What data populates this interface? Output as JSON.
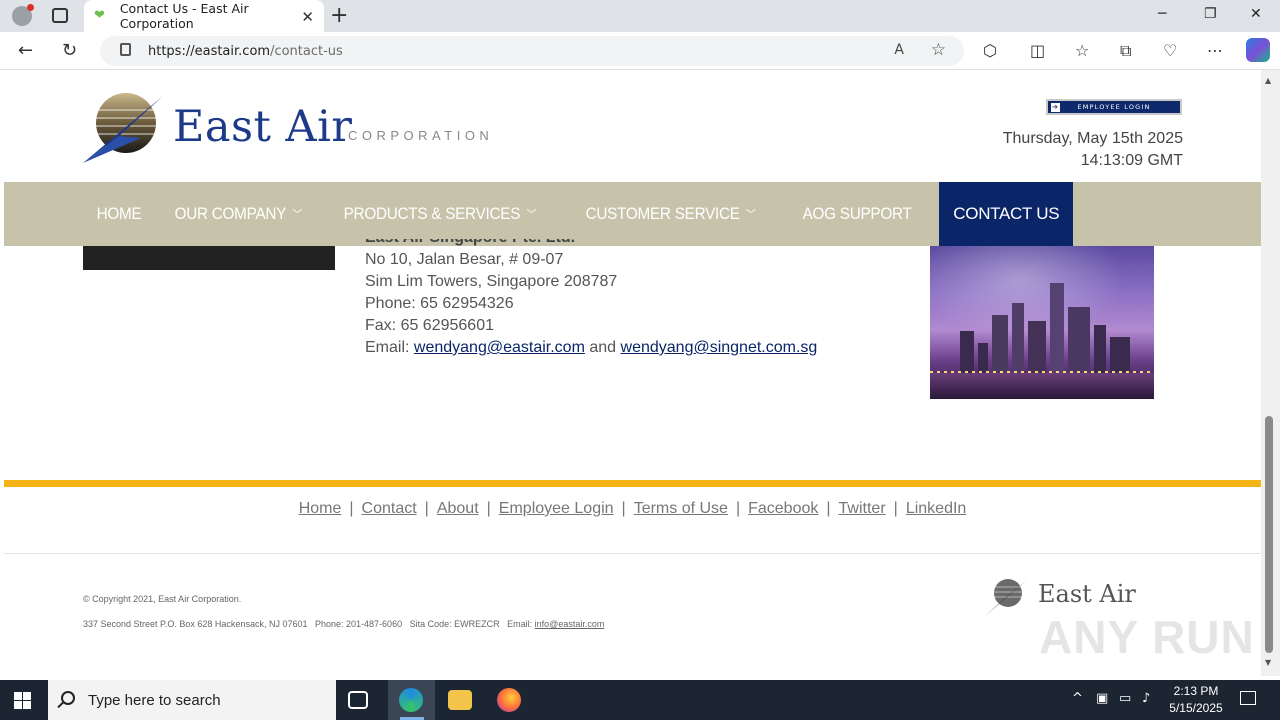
{
  "browser": {
    "tab_title": "Contact Us - East Air Corporation",
    "url_host": "https://eastair.com",
    "url_path": "/contact-us"
  },
  "header": {
    "logo_text": "East Air",
    "logo_sub": "CORPORATION",
    "employee_login": "EMPLOYEE LOGIN",
    "date": "Thursday, May 15th 2025",
    "time": "14:13:09 GMT"
  },
  "nav": {
    "items": [
      {
        "label": "HOME"
      },
      {
        "label": "OUR COMPANY"
      },
      {
        "label": "PRODUCTS & SERVICES"
      },
      {
        "label": "CUSTOMER SERVICE"
      },
      {
        "label": "AOG SUPPORT"
      },
      {
        "label": "CONTACT US"
      }
    ],
    "active_color": "#0a2668",
    "bar_color": "#c6c3aa"
  },
  "office": {
    "name": "East Air Singapore Pte. Ltd.",
    "line1": "No 10, Jalan Besar, # 09-07",
    "line2": "Sim Lim Towers, Singapore 208787",
    "phone": "Phone: 65 62954326",
    "fax": "Fax: 65 62956601",
    "email_label": "Email:",
    "email1": "wendyang@eastair.com",
    "and": "and",
    "email2": "wendyang@singnet.com.sg"
  },
  "footer": {
    "links": [
      "Home",
      "Contact",
      "About",
      "Employee Login",
      "Terms of Use",
      "Facebook",
      "Twitter",
      "LinkedIn"
    ],
    "copyright": "© Copyright 2021, East Air Corporation.",
    "address": "337 Second Street P.O. Box 628 Hackensack, NJ 07601",
    "phone": "Phone: 201-487-6060",
    "sita": "Sita Code: EWREZCR",
    "email_label": "Email:",
    "email": "info@eastair.com",
    "logo_text": "East Air",
    "accent_color": "#f5b416"
  },
  "watermark": "ANY RUN",
  "taskbar": {
    "search_placeholder": "Type here to search",
    "time": "2:13 PM",
    "date": "5/15/2025"
  }
}
